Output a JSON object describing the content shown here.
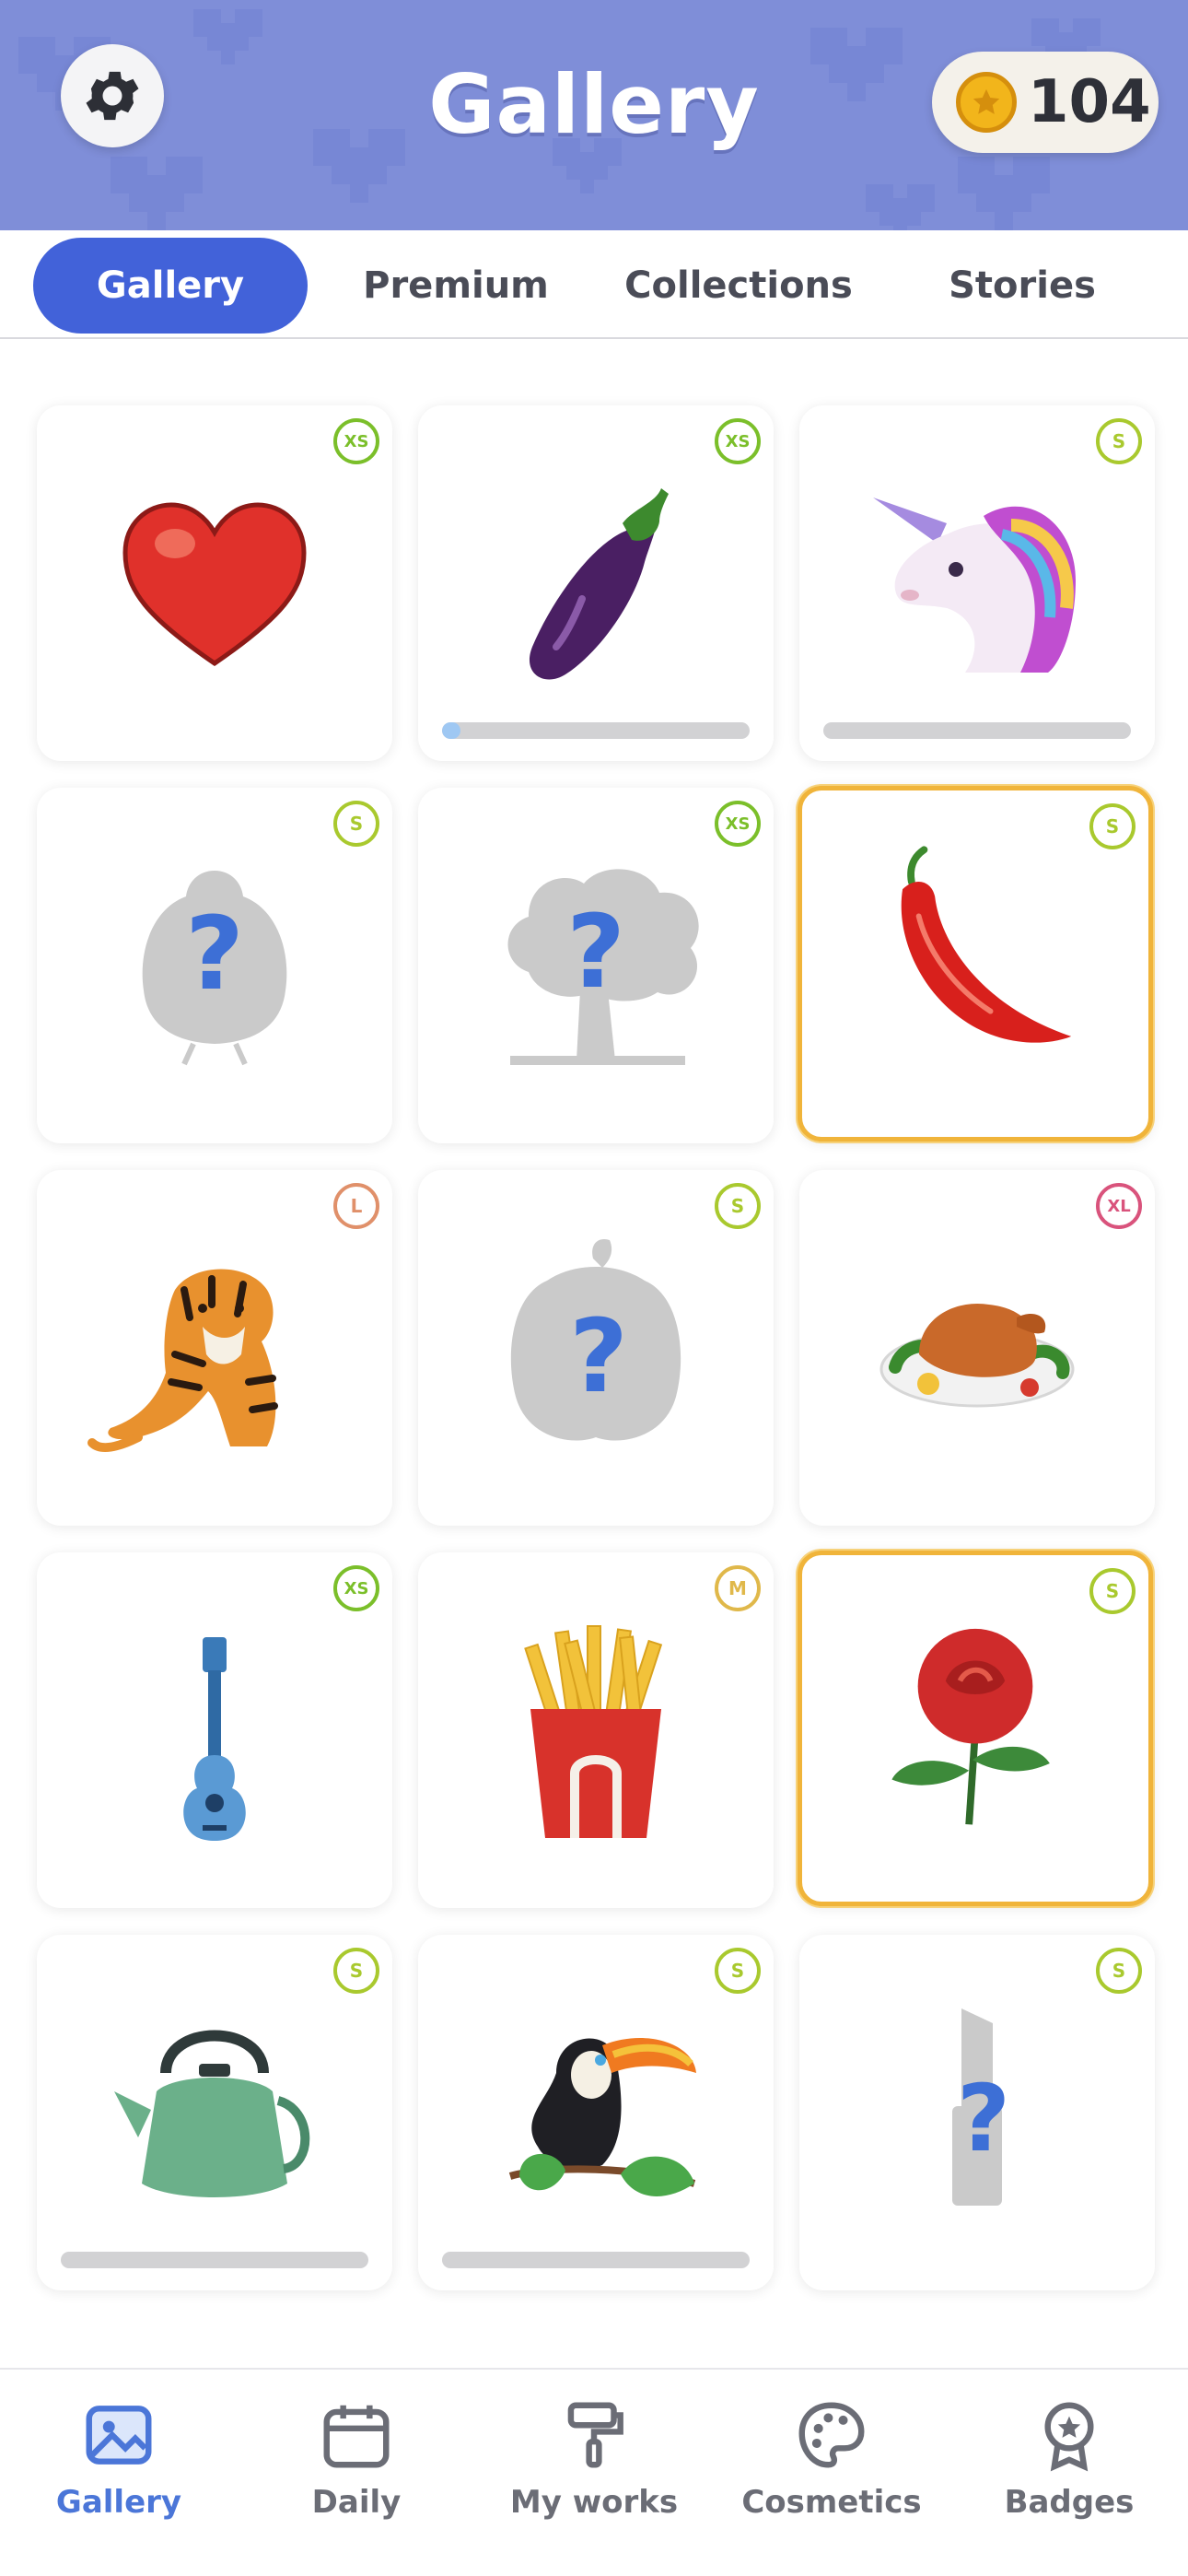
{
  "header": {
    "title": "Gallery",
    "coins": "104",
    "settings_icon": "gear-icon",
    "coin_icon": "coin-star-icon",
    "colors": {
      "background": "#7f8ed8",
      "coin": "#f2b51b"
    }
  },
  "tabs": [
    {
      "label": "Gallery",
      "active": true
    },
    {
      "label": "Premium",
      "active": false
    },
    {
      "label": "Collections",
      "active": false
    },
    {
      "label": "Stories",
      "active": false
    }
  ],
  "gallery": {
    "items": [
      {
        "name": "heart",
        "size": "XS",
        "locked": false,
        "progress": null,
        "gold": false
      },
      {
        "name": "eggplant",
        "size": "XS",
        "locked": false,
        "progress": 0.06,
        "gold": false
      },
      {
        "name": "unicorn",
        "size": "S",
        "locked": false,
        "progress": 0.0,
        "gold": false
      },
      {
        "name": "chick",
        "size": "S",
        "locked": true,
        "progress": null,
        "gold": false
      },
      {
        "name": "tree",
        "size": "XS",
        "locked": true,
        "progress": null,
        "gold": false
      },
      {
        "name": "chili-pepper",
        "size": "S",
        "locked": false,
        "progress": null,
        "gold": true
      },
      {
        "name": "tiger",
        "size": "L",
        "locked": false,
        "progress": null,
        "gold": false
      },
      {
        "name": "bell-pepper",
        "size": "S",
        "locked": true,
        "progress": null,
        "gold": false
      },
      {
        "name": "roast-chicken",
        "size": "XL",
        "locked": false,
        "progress": null,
        "gold": false
      },
      {
        "name": "ukulele",
        "size": "XS",
        "locked": false,
        "progress": null,
        "gold": false
      },
      {
        "name": "french-fries",
        "size": "M",
        "locked": false,
        "progress": null,
        "gold": false
      },
      {
        "name": "rose",
        "size": "S",
        "locked": false,
        "progress": null,
        "gold": true
      },
      {
        "name": "kettle",
        "size": "S",
        "locked": false,
        "progress": 0.0,
        "gold": false
      },
      {
        "name": "toucan",
        "size": "S",
        "locked": false,
        "progress": 0.0,
        "gold": false
      },
      {
        "name": "lipstick",
        "size": "S",
        "locked": true,
        "progress": null,
        "gold": false
      }
    ],
    "badge_colors": {
      "XS": "#7bbf2a",
      "S": "#a9c92e",
      "M": "#e0b84a",
      "L": "#e0906a",
      "XL": "#d9537c"
    }
  },
  "bottom_nav": [
    {
      "label": "Gallery",
      "icon": "image-icon",
      "active": true
    },
    {
      "label": "Daily",
      "icon": "calendar-icon",
      "active": false
    },
    {
      "label": "My works",
      "icon": "paint-roller-icon",
      "active": false
    },
    {
      "label": "Cosmetics",
      "icon": "palette-icon",
      "active": false
    },
    {
      "label": "Badges",
      "icon": "medal-icon",
      "active": false
    }
  ]
}
